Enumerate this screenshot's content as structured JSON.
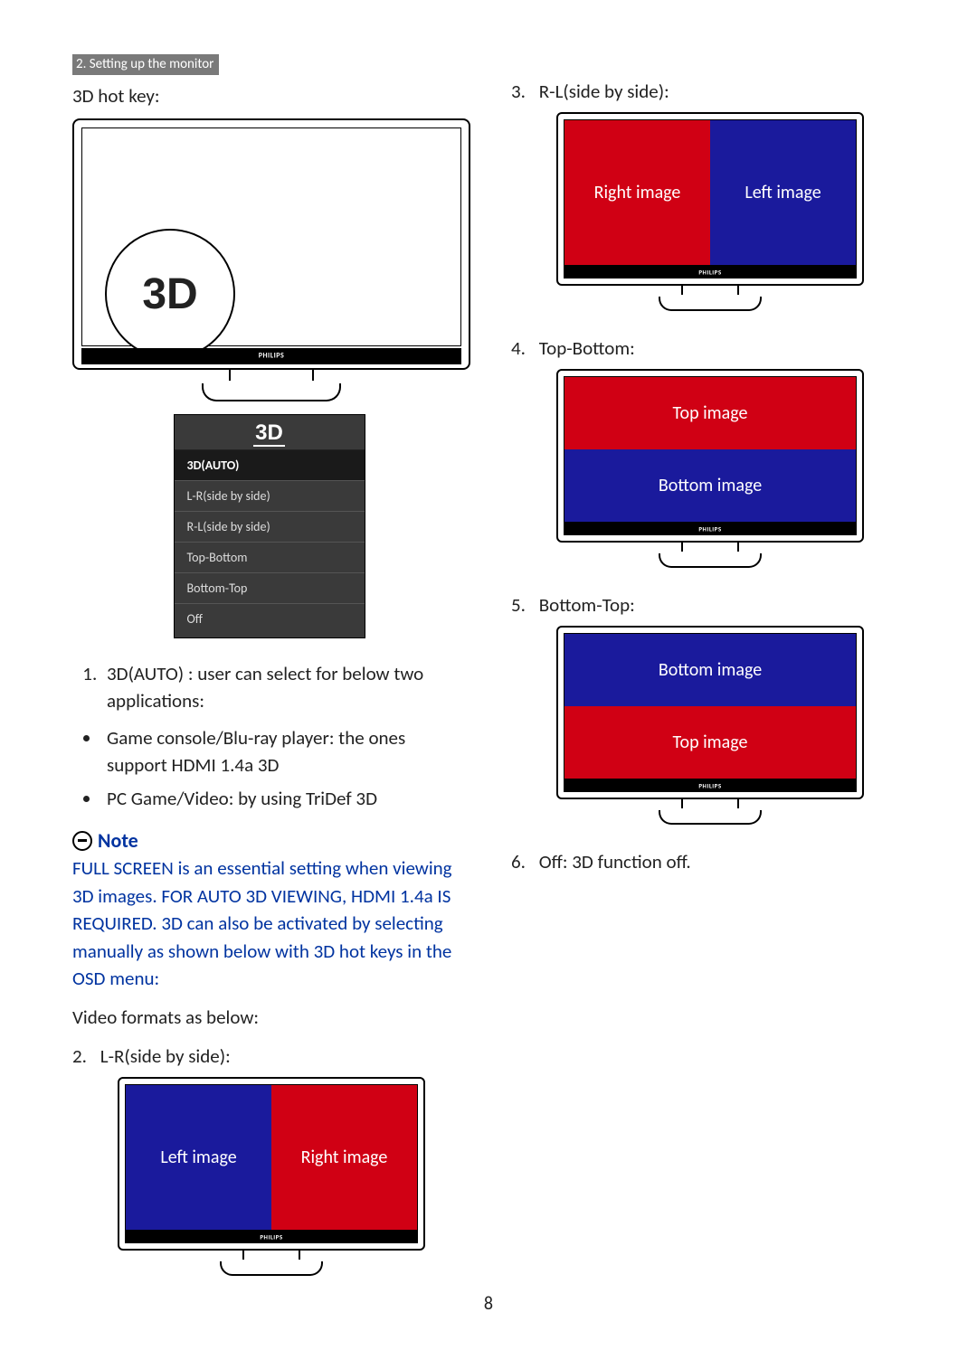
{
  "header_tag": "2. Setting up the monitor",
  "page_number": "8",
  "left": {
    "title": "3D hot key:",
    "big3d": "3D",
    "menu": {
      "title": "3D",
      "items": [
        {
          "label": "3D(AUTO)",
          "selected": true
        },
        {
          "label": "L-R(side by side)"
        },
        {
          "label": "R-L(side by side)"
        },
        {
          "label": "Top-Bottom"
        },
        {
          "label": "Bottom-Top"
        },
        {
          "label": "Off"
        }
      ]
    },
    "list1": {
      "start": 1,
      "items": [
        "3D(AUTO) : user can select for below two applications:"
      ]
    },
    "bullets": [
      "Game console/Blu-ray player: the ones support HDMI 1.4a 3D",
      "PC Game/Video: by using TriDef 3D"
    ],
    "note_label": "Note",
    "note_body": "FULL SCREEN is an essential setting when viewing 3D images. FOR AUTO 3D VIEWING, HDMI 1.4a IS REQUIRED. 3D can also be activated by selecting manually as shown below with 3D hot keys in the OSD menu:",
    "video_formats": "Video formats as below:",
    "item2": {
      "num": "2.",
      "label": "L-R(side by side):",
      "left_cell": "Left image",
      "right_cell": "Right image"
    }
  },
  "right": {
    "item3": {
      "num": "3.",
      "label": "R-L(side by side):",
      "left_cell": "Right image",
      "right_cell": "Left image"
    },
    "item4": {
      "num": "4.",
      "label": "Top-Bottom:",
      "top_cell": "Top image",
      "bottom_cell": "Bottom image"
    },
    "item5": {
      "num": "5.",
      "label": "Bottom-Top:",
      "top_cell": "Bottom image",
      "bottom_cell": "Top image"
    },
    "item6": {
      "num": "6.",
      "label": "Off: 3D function off."
    }
  }
}
